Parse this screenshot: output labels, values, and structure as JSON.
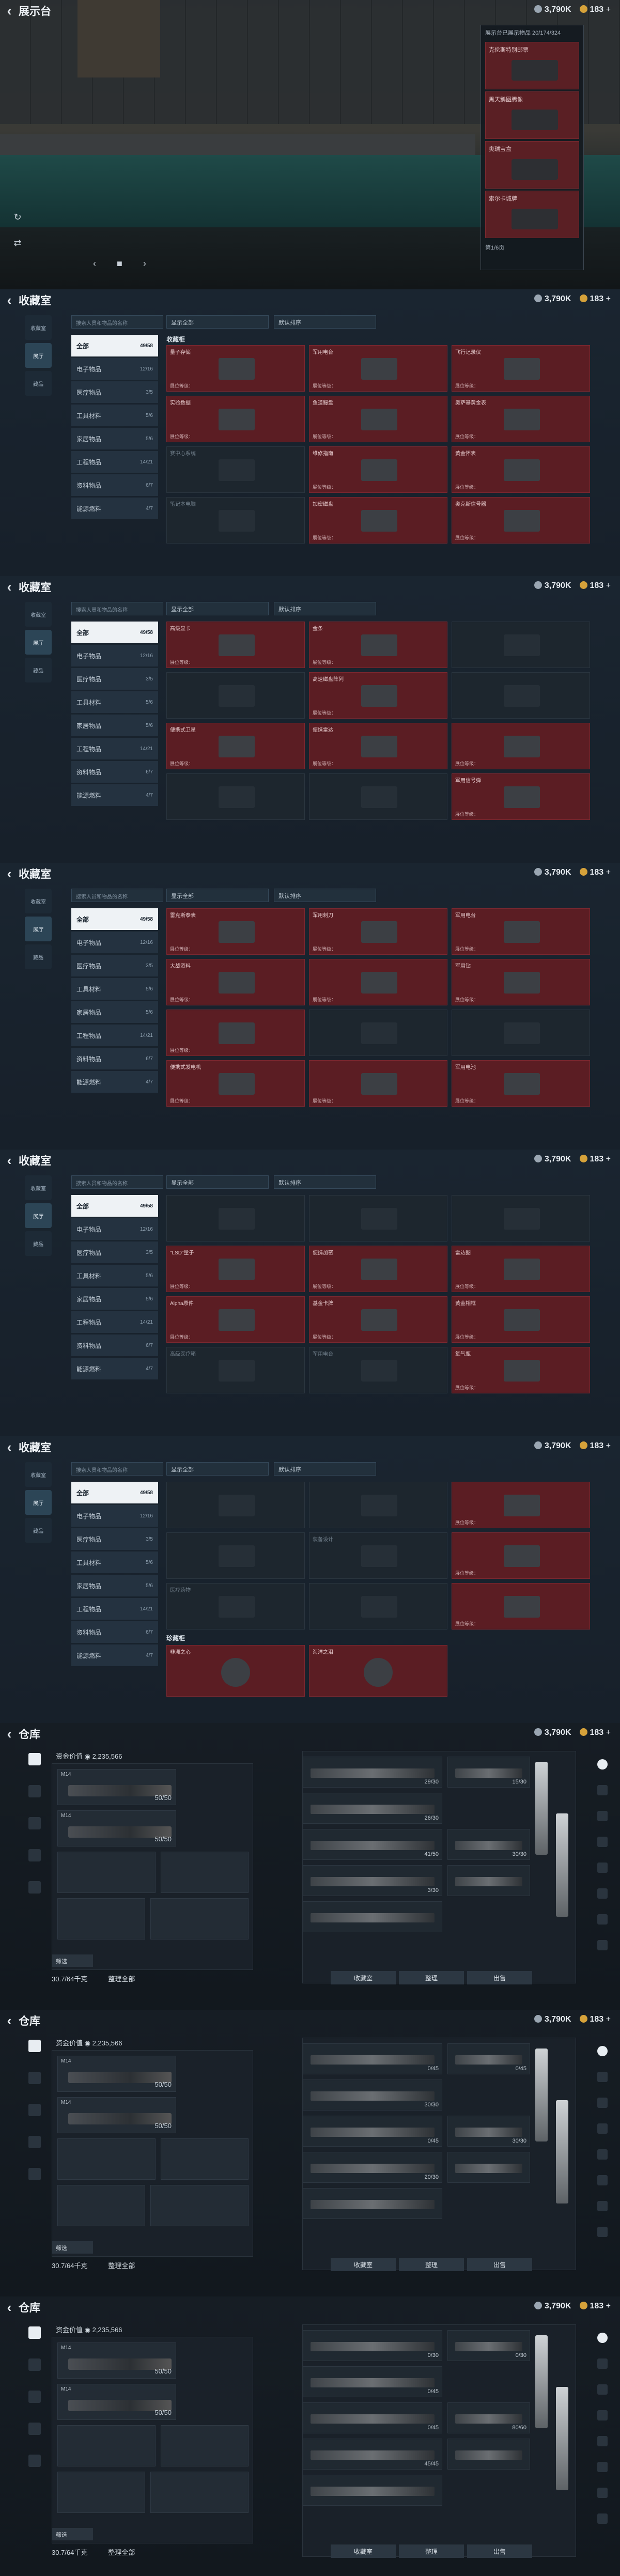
{
  "currency": {
    "silver": "3,790K",
    "gold": "183"
  },
  "showcase": {
    "title": "展示台",
    "panel_header": "展示台已展示物品 20/174/324",
    "items": [
      "克伦斯特别邮票",
      "黑天鹅图腾像",
      "奥瑞宝盒",
      "索尔卡城牌"
    ],
    "panel_footer": "第1/6页"
  },
  "collection": {
    "title": "收藏室",
    "search_placeholder": "搜索人员和物品的名称",
    "filter": "显示全部",
    "sort": "默认排序",
    "nav": [
      {
        "label": "收藏室"
      },
      {
        "label": "展厅"
      },
      {
        "label": "藏品"
      }
    ],
    "categories": [
      {
        "label": "全部",
        "count": "49/58"
      },
      {
        "label": "电子物品",
        "count": "12/16"
      },
      {
        "label": "医疗物品",
        "count": "3/5"
      },
      {
        "label": "工具材料",
        "count": "5/6"
      },
      {
        "label": "家居物品",
        "count": "5/6"
      },
      {
        "label": "工程物品",
        "count": "14/21"
      },
      {
        "label": "资料物品",
        "count": "6/7"
      },
      {
        "label": "能源燃料",
        "count": "4/7"
      }
    ],
    "section_label": "收藏柜",
    "level_prefix": "展位等级："
  },
  "collection_views": [
    {
      "cells": [
        "量子存储",
        "军用电台",
        "飞行记录仪",
        "实验数据",
        "鱼道鳗盘",
        "奥萨基黄金表",
        "赛中心系统",
        "维修指南",
        "黄金怀表",
        "笔记本电脑",
        "加密磁盘",
        "奥克斯信号器"
      ],
      "dark": [
        6,
        9
      ]
    },
    {
      "cells": [
        "高级显卡",
        "金条",
        "",
        "",
        "高速磁盘阵列",
        "",
        "便携式卫星",
        "便携雷达",
        "",
        "",
        "",
        "军用信号弹"
      ],
      "dark": [
        2,
        3,
        5,
        9,
        10
      ]
    },
    {
      "cells": [
        "雷克斯泰表",
        "军用刺刀",
        "军用电台",
        "大战资料",
        "",
        "军用钻",
        "",
        "",
        "",
        "便携式发电机",
        "",
        "军用电池"
      ],
      "dark": [
        7,
        8
      ]
    },
    {
      "cells": [
        "",
        "",
        "",
        "\"LSD\"量子",
        "便携加密",
        "雷达图",
        "Alpha原件",
        "基金卡牌",
        "黄金相框",
        "高级医疗箱",
        "军用电台",
        "氧气瓶"
      ],
      "dark": [
        0,
        1,
        2,
        9,
        10
      ]
    },
    {
      "cells": [
        "",
        "",
        "",
        "",
        "装备设计",
        "",
        "医疗药物",
        "",
        "",
        "",
        "",
        ""
      ],
      "dark": [
        0,
        1,
        3,
        4,
        6,
        7,
        9,
        10
      ],
      "rare_label": "珍藏柜",
      "rare": [
        "非洲之心",
        "海洋之泪"
      ]
    }
  ],
  "warehouse": {
    "title": "仓库",
    "value_label": "资金价值",
    "value": "2,235,566",
    "weapon": "M14",
    "weapon_sub": "7.62x51mm",
    "ammo": "50/50",
    "sort_btn": "筛选",
    "capacity": "30.7/64千克",
    "discard_all": "整理全部",
    "buttons": [
      "收藏室",
      "整理",
      "出售"
    ]
  },
  "warehouse_right": [
    {
      "caps": [
        "29/30",
        "15/30",
        "26/30",
        "41/50",
        "30/30",
        "3/30"
      ]
    },
    {
      "caps": [
        "0/45",
        "0/45",
        "30/30",
        "0/45",
        "30/30",
        "20/30"
      ]
    },
    {
      "caps": [
        "0/30",
        "0/30",
        "0/45",
        "0/45",
        "80/60",
        "45/45"
      ]
    }
  ]
}
